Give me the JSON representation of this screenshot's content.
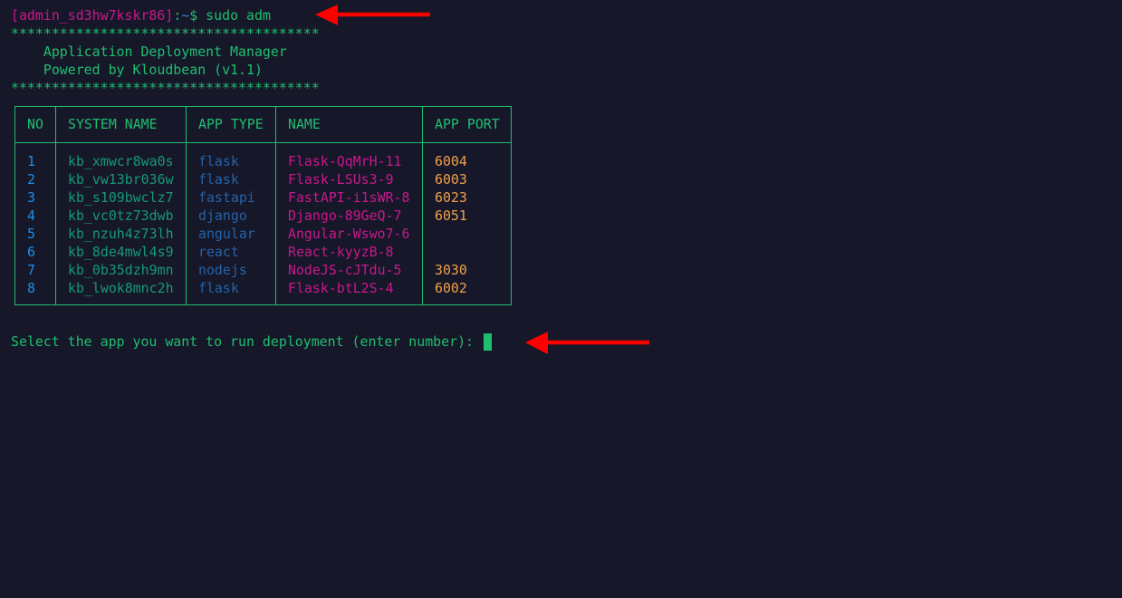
{
  "terminal": {
    "prompt": {
      "user_host": "[admin_sd3hw7kskr86]",
      "colon": ":",
      "path": "~",
      "symbol": "$",
      "command": " sudo adm"
    },
    "banner": {
      "border": "**************************************",
      "title": "    Application Deployment Manager",
      "subtitle": "    Powered by Kloudbean (v1.1)"
    },
    "table": {
      "headers": [
        "NO",
        "SYSTEM NAME",
        "APP TYPE",
        "NAME",
        "APP PORT"
      ],
      "rows": [
        {
          "no": "1",
          "system_name": "kb_xmwcr8wa0s",
          "app_type": "flask",
          "name": "Flask-QqMrH-11",
          "port": "6004"
        },
        {
          "no": "2",
          "system_name": "kb_vw13br036w",
          "app_type": "flask",
          "name": "Flask-LSUs3-9",
          "port": "6003"
        },
        {
          "no": "3",
          "system_name": "kb_s109bwclz7",
          "app_type": "fastapi",
          "name": "FastAPI-i1sWR-8",
          "port": "6023"
        },
        {
          "no": "4",
          "system_name": "kb_vc0tz73dwb",
          "app_type": "django",
          "name": "Django-89GeQ-7",
          "port": "6051"
        },
        {
          "no": "5",
          "system_name": "kb_nzuh4z73lh",
          "app_type": "angular",
          "name": "Angular-Wswo7-6",
          "port": ""
        },
        {
          "no": "6",
          "system_name": "kb_8de4mwl4s9",
          "app_type": "react",
          "name": "React-kyyzB-8",
          "port": ""
        },
        {
          "no": "7",
          "system_name": "kb_0b35dzh9mn",
          "app_type": "nodejs",
          "name": "NodeJS-cJTdu-5",
          "port": "3030"
        },
        {
          "no": "8",
          "system_name": "kb_lwok8mnc2h",
          "app_type": "flask",
          "name": "Flask-btL2S-4",
          "port": "6002"
        }
      ]
    },
    "input_prompt": "Select the app you want to run deployment (enter number): ",
    "input_value": ""
  },
  "colors": {
    "background": "#161729",
    "accent_green": "#1fbf6f",
    "user_magenta": "#c7198c",
    "path_blue": "#2a8ad8",
    "number_blue": "#1e8fe6",
    "type_blue": "#2563a8",
    "port_orange": "#f0a04b",
    "annotation_arrow": "#ff0000"
  },
  "annotations": {
    "arrows": [
      {
        "name": "command-arrow",
        "points_to": "sudo adm command",
        "direction": "left"
      },
      {
        "name": "input-arrow",
        "points_to": "deployment selection prompt",
        "direction": "left"
      }
    ]
  }
}
